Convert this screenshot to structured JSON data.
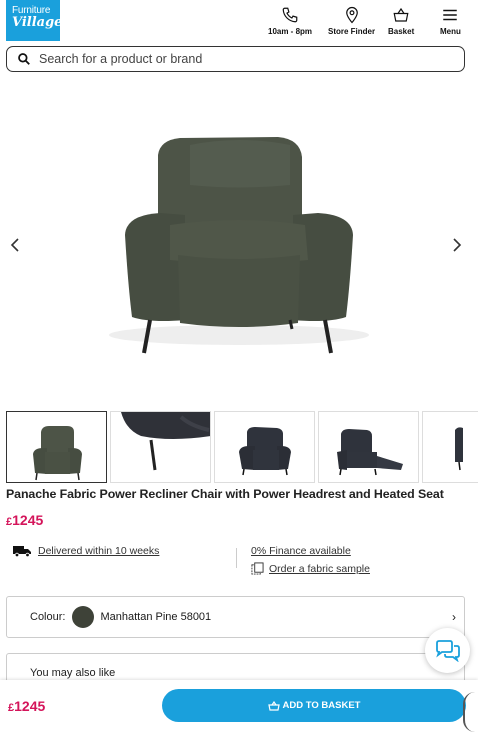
{
  "header": {
    "logo_line1": "Furniture",
    "logo_line2": "Village",
    "hours": "10am - 8pm",
    "store_finder": "Store Finder",
    "basket": "Basket",
    "menu": "Menu"
  },
  "search": {
    "placeholder": "Search for a product or brand"
  },
  "product": {
    "title": "Panache Fabric Power Recliner Chair with Power Headrest and Heated Seat",
    "currency": "£",
    "price": "1245"
  },
  "delivery": {
    "text": "Delivered within 10 weeks",
    "finance": "0% Finance available",
    "sample": "Order a fabric sample"
  },
  "colour": {
    "label": "Colour:",
    "value": "Manhattan Pine 58001",
    "swatch_color": "#3e4238"
  },
  "also_like": {
    "label": "You may also like"
  },
  "sticky": {
    "currency": "£",
    "price": "1245",
    "button": "ADD TO BASKET"
  },
  "colors": {
    "brand_blue": "#1aa0dc",
    "price_pink": "#d4145a"
  },
  "icons": [
    "phone-icon",
    "map-pin-icon",
    "basket-icon",
    "menu-icon",
    "search-icon",
    "chevron-left-icon",
    "chevron-right-icon",
    "delivery-truck-icon",
    "fabric-sample-icon",
    "chat-icon"
  ]
}
